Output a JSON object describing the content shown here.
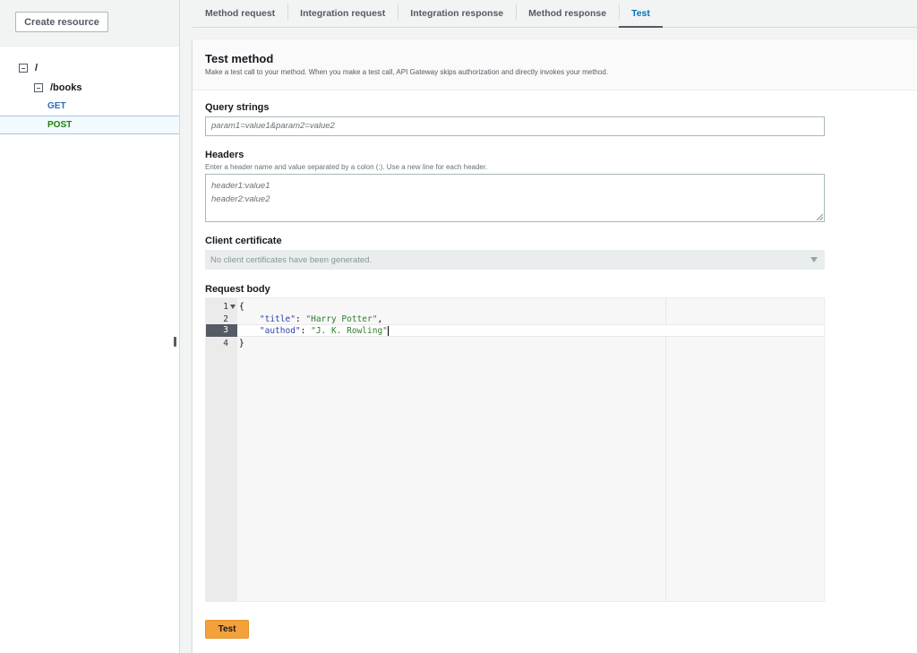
{
  "sidebar": {
    "create_resource_label": "Create resource",
    "tree": {
      "root": {
        "label": "/",
        "expanded": true
      },
      "books": {
        "label": "/books",
        "expanded": true
      },
      "methods": [
        {
          "label": "GET",
          "color": "#2a6ebb",
          "selected": false
        },
        {
          "label": "POST",
          "color": "#1d8102",
          "selected": true
        }
      ]
    }
  },
  "tabs": [
    {
      "label": "Method request",
      "active": false
    },
    {
      "label": "Integration request",
      "active": false
    },
    {
      "label": "Integration response",
      "active": false
    },
    {
      "label": "Method response",
      "active": false
    },
    {
      "label": "Test",
      "active": true
    }
  ],
  "panel": {
    "title": "Test method",
    "description": "Make a test call to your method. When you make a test call, API Gateway skips authorization and directly invokes your method.",
    "query_strings": {
      "label": "Query strings",
      "placeholder": "param1=value1&param2=value2",
      "value": ""
    },
    "headers": {
      "label": "Headers",
      "help": "Enter a header name and value separated by a colon (:). Use a new line for each header.",
      "placeholder_lines": [
        "header1:value1",
        "header2:value2"
      ],
      "value": ""
    },
    "client_certificate": {
      "label": "Client certificate",
      "selected": "No client certificates have been generated."
    },
    "request_body": {
      "label": "Request body",
      "active_line": 3,
      "lines": [
        {
          "num": "1",
          "text": "{"
        },
        {
          "num": "2",
          "key": "\"title\"",
          "value": "\"Harry Potter\"",
          "suffix": ","
        },
        {
          "num": "3",
          "key": "\"authod\"",
          "value": "\"J. K. Rowling\"",
          "suffix": ""
        },
        {
          "num": "4",
          "text": "}"
        }
      ]
    },
    "test_button_label": "Test"
  },
  "colors": {
    "accent_orange": "#f4a13b",
    "link_blue": "#0073bb",
    "get_blue": "#2a6ebb",
    "post_green": "#1d8102"
  }
}
